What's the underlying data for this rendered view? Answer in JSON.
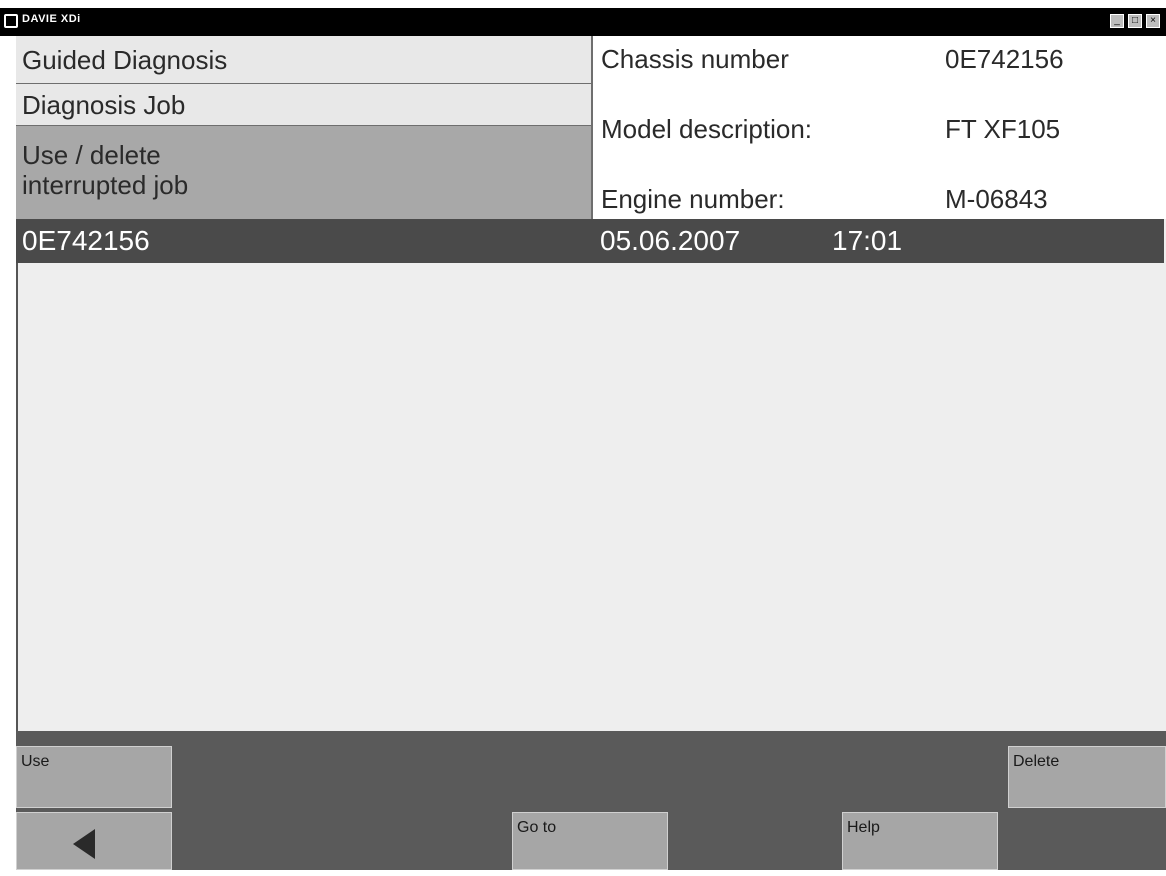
{
  "window": {
    "title": "DAVIE XDi",
    "controls": {
      "minimize": "_",
      "maximize": "□",
      "close": "×"
    }
  },
  "nav": {
    "items": [
      "Guided Diagnosis",
      "Diagnosis Job"
    ],
    "active_line1": "Use / delete",
    "active_line2": "interrupted job"
  },
  "vehicle": {
    "chassis_label": "Chassis number",
    "chassis_value": "0E742156",
    "model_label": "Model description:",
    "model_value": "FT XF105",
    "engine_label": "Engine number:",
    "engine_value": "M-06843"
  },
  "jobs": [
    {
      "chassis": "0E742156",
      "date": "05.06.2007",
      "time": "17:01",
      "selected": true
    }
  ],
  "buttons": {
    "use": "Use",
    "delete": "Delete",
    "goto": "Go to",
    "help": "Help",
    "back_icon": "left-triangle"
  },
  "colors": {
    "selected_row": "#4a4a4a",
    "active_nav": "#a8a8a8",
    "button_bar": "#5a5a5a",
    "button": "#a6a6a6"
  }
}
